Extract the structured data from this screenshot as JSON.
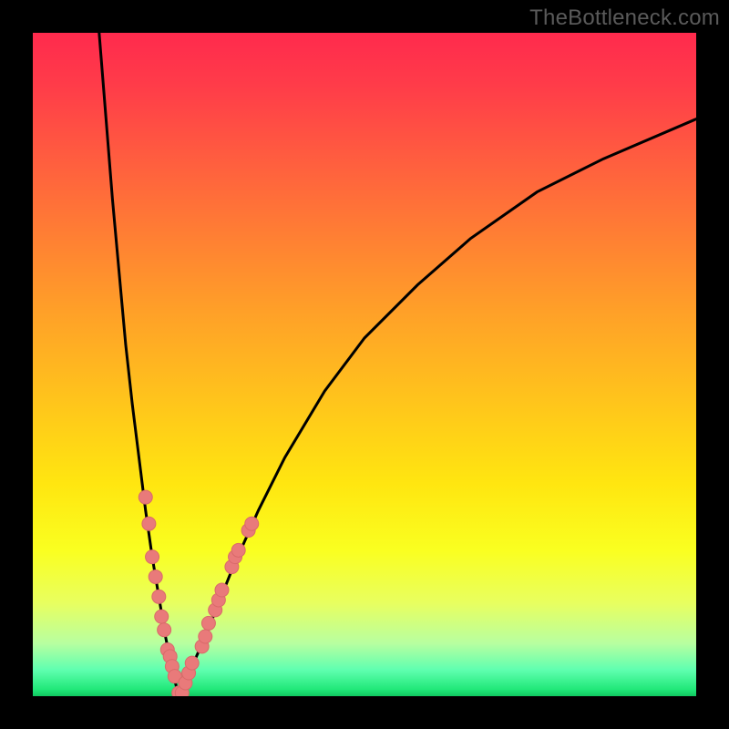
{
  "watermark": {
    "text": "TheBottleneck.com"
  },
  "colors": {
    "frame": "#000000",
    "curve": "#000000",
    "marker_fill": "#e97a7a",
    "marker_stroke": "#d96a6a",
    "gradient_top": "#ff2a4d",
    "gradient_bottom": "#10c860"
  },
  "chart_data": {
    "type": "line",
    "title": "",
    "xlabel": "",
    "ylabel": "",
    "xlim": [
      0,
      100
    ],
    "ylim": [
      0,
      100
    ],
    "grid": false,
    "legend": false,
    "apex_x": 22,
    "series": [
      {
        "name": "left_branch",
        "x": [
          10,
          12,
          14,
          15,
          16,
          17,
          18,
          19,
          20,
          21,
          22
        ],
        "y": [
          100,
          75,
          53,
          44,
          36,
          28,
          21,
          15,
          9,
          4,
          0
        ]
      },
      {
        "name": "right_branch",
        "x": [
          22,
          24,
          26,
          28,
          30,
          34,
          38,
          44,
          50,
          58,
          66,
          76,
          86,
          100
        ],
        "y": [
          0,
          4.5,
          9,
          14,
          19,
          28,
          36,
          46,
          54,
          62,
          69,
          76,
          81,
          87
        ]
      }
    ],
    "markers": [
      {
        "cluster": "left",
        "x": 17.0,
        "y": 30
      },
      {
        "cluster": "left",
        "x": 17.5,
        "y": 26
      },
      {
        "cluster": "left",
        "x": 18.0,
        "y": 21
      },
      {
        "cluster": "left",
        "x": 18.5,
        "y": 18
      },
      {
        "cluster": "left",
        "x": 19.0,
        "y": 15
      },
      {
        "cluster": "left",
        "x": 19.4,
        "y": 12
      },
      {
        "cluster": "left",
        "x": 19.8,
        "y": 10
      },
      {
        "cluster": "left",
        "x": 20.3,
        "y": 7
      },
      {
        "cluster": "left",
        "x": 20.7,
        "y": 6
      },
      {
        "cluster": "valley",
        "x": 21.0,
        "y": 4.5
      },
      {
        "cluster": "valley",
        "x": 21.4,
        "y": 3
      },
      {
        "cluster": "valley",
        "x": 22.0,
        "y": 0.5
      },
      {
        "cluster": "valley",
        "x": 22.5,
        "y": 0.5
      },
      {
        "cluster": "valley",
        "x": 23.0,
        "y": 2
      },
      {
        "cluster": "valley",
        "x": 23.5,
        "y": 3.5
      },
      {
        "cluster": "valley",
        "x": 24.0,
        "y": 5
      },
      {
        "cluster": "right",
        "x": 25.5,
        "y": 7.5
      },
      {
        "cluster": "right",
        "x": 26.0,
        "y": 9
      },
      {
        "cluster": "right",
        "x": 26.5,
        "y": 11
      },
      {
        "cluster": "right",
        "x": 27.5,
        "y": 13
      },
      {
        "cluster": "right",
        "x": 28.0,
        "y": 14.5
      },
      {
        "cluster": "right",
        "x": 28.5,
        "y": 16
      },
      {
        "cluster": "right",
        "x": 30.0,
        "y": 19.5
      },
      {
        "cluster": "right",
        "x": 30.5,
        "y": 21
      },
      {
        "cluster": "right",
        "x": 31.0,
        "y": 22
      },
      {
        "cluster": "right",
        "x": 32.5,
        "y": 25
      },
      {
        "cluster": "right",
        "x": 33.0,
        "y": 26
      }
    ]
  }
}
